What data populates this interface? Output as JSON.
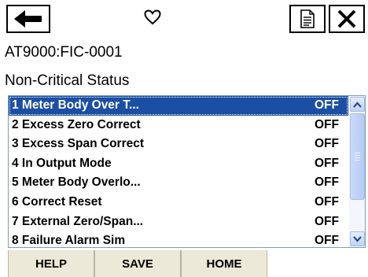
{
  "toolbar": {
    "back_icon": "left-arrow-icon",
    "favorite_icon": "heart-outline-icon",
    "document_icon": "document-icon",
    "close_icon": "close-icon"
  },
  "device": {
    "tag": "AT9000:FIC-0001"
  },
  "section": {
    "title": "Non-Critical Status"
  },
  "status_list": {
    "items": [
      {
        "label": "1 Meter Body Over T...",
        "value": "OFF",
        "selected": true
      },
      {
        "label": "2 Excess Zero Correct",
        "value": "OFF",
        "selected": false
      },
      {
        "label": "3 Excess Span Correct",
        "value": "OFF",
        "selected": false
      },
      {
        "label": "4 In Output Mode",
        "value": "OFF",
        "selected": false
      },
      {
        "label": "5 Meter Body Overlo...",
        "value": "OFF",
        "selected": false
      },
      {
        "label": "6 Correct Reset",
        "value": "OFF",
        "selected": false
      },
      {
        "label": "7 External Zero/Span...",
        "value": "OFF",
        "selected": false
      },
      {
        "label": "8 Failure Alarm Sim",
        "value": "OFF",
        "selected": false
      }
    ]
  },
  "footer": {
    "help_label": "HELP",
    "save_label": "SAVE",
    "home_label": "HOME"
  },
  "colors": {
    "selection": "#1c4fa3",
    "button_face": "#ece9d8",
    "scrollbar": "#bfd3f5"
  }
}
